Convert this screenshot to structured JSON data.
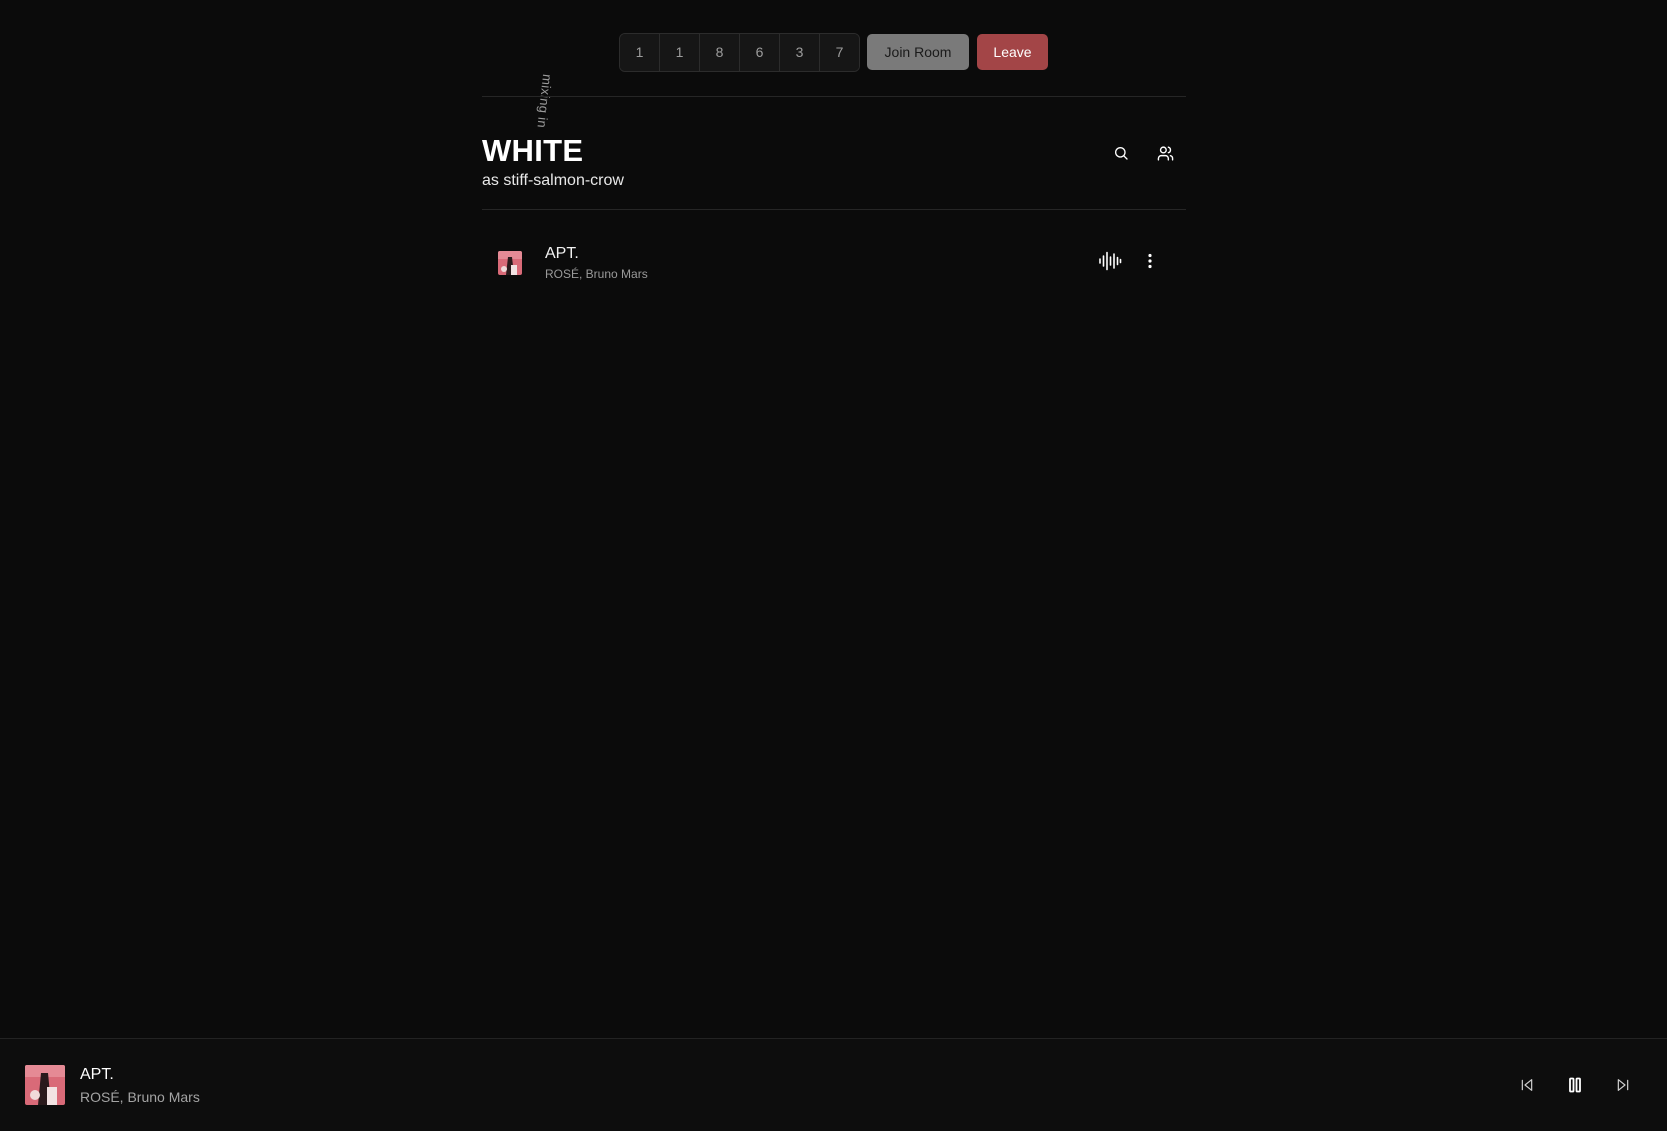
{
  "topbar": {
    "mixing_label": "mixing in",
    "room_code": [
      "1",
      "1",
      "8",
      "6",
      "3",
      "7"
    ],
    "join_label": "Join Room",
    "leave_label": "Leave"
  },
  "header": {
    "title": "WHITE",
    "subtitle": "as stiff-salmon-crow",
    "search_icon": "search-icon",
    "users_icon": "users-icon"
  },
  "queue": [
    {
      "title": "APT.",
      "artist": "ROSÉ, Bruno Mars",
      "status_icon": "waveform-icon",
      "menu_icon": "more-vertical-icon"
    }
  ],
  "player": {
    "title": "APT.",
    "artist": "ROSÉ, Bruno Mars",
    "controls": [
      "skip-back-icon",
      "pause-icon",
      "skip-forward-icon"
    ]
  },
  "colors": {
    "background": "#0b0b0b",
    "leave": "#a34547",
    "join": "#7a7a7a",
    "album_pink": "#d96a78"
  }
}
